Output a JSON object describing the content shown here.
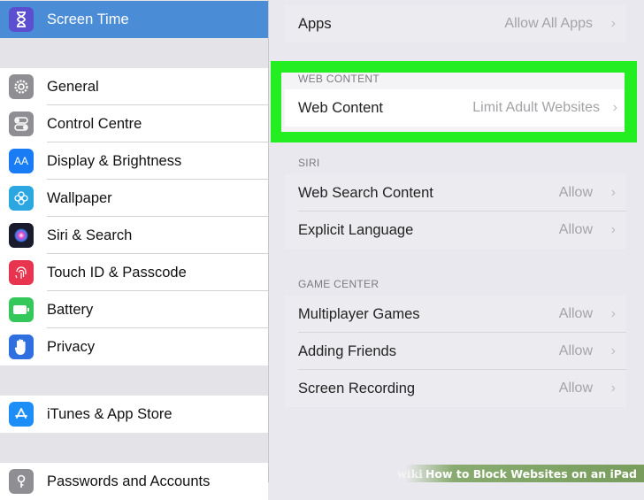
{
  "sidebar": {
    "items": [
      {
        "label": "Screen Time",
        "icon": "hourglass-icon",
        "color": "#5b4fd0"
      },
      {
        "label": "General",
        "icon": "gear-icon",
        "color": "#8e8e93"
      },
      {
        "label": "Control Centre",
        "icon": "toggles-icon",
        "color": "#8e8e93"
      },
      {
        "label": "Display & Brightness",
        "icon": "display-aa-icon",
        "color": "#1a7cf4"
      },
      {
        "label": "Wallpaper",
        "icon": "flower-icon",
        "color": "#2aa7e0"
      },
      {
        "label": "Siri & Search",
        "icon": "siri-icon",
        "color": "#1b1b2e"
      },
      {
        "label": "Touch ID & Passcode",
        "icon": "fingerprint-icon",
        "color": "#e8344e"
      },
      {
        "label": "Battery",
        "icon": "battery-icon",
        "color": "#34c759"
      },
      {
        "label": "Privacy",
        "icon": "hand-icon",
        "color": "#2f6fe0"
      },
      {
        "label": "iTunes & App Store",
        "icon": "app-store-icon",
        "color": "#1c8ef5"
      },
      {
        "label": "Passwords and Accounts",
        "icon": "key-icon",
        "color": "#8e8e93"
      }
    ]
  },
  "main": {
    "apps_row": {
      "label": "Apps",
      "value": "Allow All Apps"
    },
    "web_content": {
      "title": "WEB CONTENT",
      "row": {
        "label": "Web Content",
        "value": "Limit Adult Websites"
      }
    },
    "siri": {
      "title": "SIRI",
      "rows": [
        {
          "label": "Web Search Content",
          "value": "Allow"
        },
        {
          "label": "Explicit Language",
          "value": "Allow"
        }
      ]
    },
    "game_center": {
      "title": "GAME CENTER",
      "rows": [
        {
          "label": "Multiplayer Games",
          "value": "Allow"
        },
        {
          "label": "Adding Friends",
          "value": "Allow"
        },
        {
          "label": "Screen Recording",
          "value": "Allow"
        }
      ]
    },
    "chevron": "›"
  },
  "highlight_color": "#22ee22",
  "watermark": {
    "wiki": "wiki",
    "text": "How to Block Websites on an iPad"
  }
}
